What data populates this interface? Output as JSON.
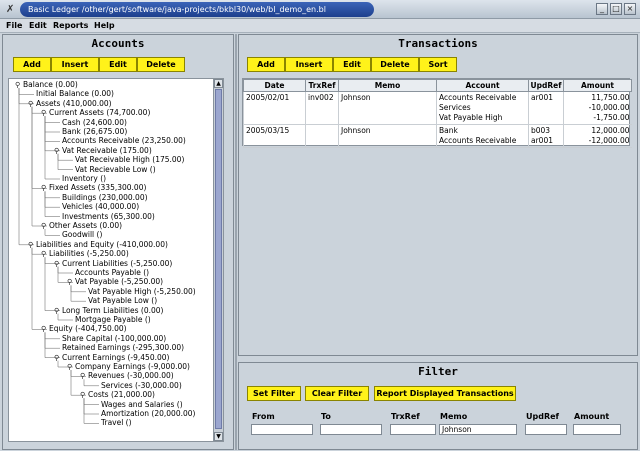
{
  "window": {
    "title": "Basic Ledger  /other/gert/software/java-projects/bkbl30/web/bl_demo_en.bl",
    "controls": [
      "_",
      "□",
      "×"
    ]
  },
  "menu": [
    "File",
    "Edit",
    "Reports",
    "Help"
  ],
  "accounts": {
    "title": "Accounts",
    "buttons": [
      "Add",
      "Insert",
      "Edit",
      "Delete"
    ],
    "tree": [
      {
        "label": "Balance (0.00)",
        "depth": 0,
        "key": true
      },
      {
        "label": "Initial Balance (0.00)",
        "depth": 1,
        "key": false
      },
      {
        "label": "Assets (410,000.00)",
        "depth": 1,
        "key": true
      },
      {
        "label": "Current Assets (74,700.00)",
        "depth": 2,
        "key": true
      },
      {
        "label": "Cash (24,600.00)",
        "depth": 3,
        "key": false
      },
      {
        "label": "Bank (26,675.00)",
        "depth": 3,
        "key": false
      },
      {
        "label": "Accounts Receivable (23,250.00)",
        "depth": 3,
        "key": false
      },
      {
        "label": "Vat Receivable (175.00)",
        "depth": 3,
        "key": true
      },
      {
        "label": "Vat Receivable High (175.00)",
        "depth": 4,
        "key": false
      },
      {
        "label": "Vat Recievable Low ()",
        "depth": 4,
        "key": false
      },
      {
        "label": "Inventory ()",
        "depth": 3,
        "key": false
      },
      {
        "label": "Fixed Assets (335,300.00)",
        "depth": 2,
        "key": true
      },
      {
        "label": "Buildings (230,000.00)",
        "depth": 3,
        "key": false
      },
      {
        "label": "Vehicles (40,000.00)",
        "depth": 3,
        "key": false
      },
      {
        "label": "Investments (65,300.00)",
        "depth": 3,
        "key": false
      },
      {
        "label": "Other Assets (0.00)",
        "depth": 2,
        "key": true
      },
      {
        "label": "Goodwill ()",
        "depth": 3,
        "key": false
      },
      {
        "label": "Liabilities and Equity (-410,000.00)",
        "depth": 1,
        "key": true
      },
      {
        "label": "Liabilities (-5,250.00)",
        "depth": 2,
        "key": true
      },
      {
        "label": "Current Liabilities (-5,250.00)",
        "depth": 3,
        "key": true
      },
      {
        "label": "Accounts Payable ()",
        "depth": 4,
        "key": false
      },
      {
        "label": "Vat Payable (-5,250.00)",
        "depth": 4,
        "key": true
      },
      {
        "label": "Vat Payable High (-5,250.00)",
        "depth": 5,
        "key": false
      },
      {
        "label": "Vat Payable Low ()",
        "depth": 5,
        "key": false
      },
      {
        "label": "Long Term Liabilities (0.00)",
        "depth": 3,
        "key": true
      },
      {
        "label": "Mortgage Payable ()",
        "depth": 4,
        "key": false
      },
      {
        "label": "Equity (-404,750.00)",
        "depth": 2,
        "key": true
      },
      {
        "label": "Share Capital (-100,000.00)",
        "depth": 3,
        "key": false
      },
      {
        "label": "Retained Earnings (-295,300.00)",
        "depth": 3,
        "key": false
      },
      {
        "label": "Current Earnings (-9,450.00)",
        "depth": 3,
        "key": true
      },
      {
        "label": "Company Earnings (-9,000.00)",
        "depth": 4,
        "key": true
      },
      {
        "label": "Revenues (-30,000.00)",
        "depth": 5,
        "key": true
      },
      {
        "label": "Services (-30,000.00)",
        "depth": 6,
        "key": false
      },
      {
        "label": "Costs (21,000.00)",
        "depth": 5,
        "key": true
      },
      {
        "label": "Wages and Salaries ()",
        "depth": 6,
        "key": false
      },
      {
        "label": "Amortization (20,000.00)",
        "depth": 6,
        "key": false
      },
      {
        "label": "Travel ()",
        "depth": 6,
        "key": false
      }
    ]
  },
  "transactions": {
    "title": "Transactions",
    "buttons": [
      "Add",
      "Insert",
      "Edit",
      "Delete",
      "Sort"
    ],
    "columns": [
      "Date",
      "TrxRef",
      "Memo",
      "Account",
      "UpdRef",
      "Amount"
    ],
    "rows": [
      {
        "date": "2005/02/01",
        "trxref": "inv002",
        "memo": "Johnson",
        "accounts": [
          "Accounts Receivable",
          "Services",
          "Vat Payable High"
        ],
        "updrefs": [
          "ar001",
          "",
          ""
        ],
        "amounts": [
          "11,750.00",
          "-10,000.00",
          "-1,750.00"
        ]
      },
      {
        "date": "2005/03/15",
        "trxref": "",
        "memo": "Johnson",
        "accounts": [
          "Bank",
          "Accounts Receivable"
        ],
        "updrefs": [
          "b003",
          "ar001"
        ],
        "amounts": [
          "12,000.00",
          "-12,000.00"
        ]
      }
    ]
  },
  "filter": {
    "title": "Filter",
    "buttons": [
      "Set Filter",
      "Clear Filter",
      "Report Displayed Transactions"
    ],
    "fields": [
      {
        "label": "From",
        "value": ""
      },
      {
        "label": "To",
        "value": ""
      },
      {
        "label": "TrxRef",
        "value": ""
      },
      {
        "label": "Memo",
        "value": "Johnson"
      },
      {
        "label": "UpdRef",
        "value": ""
      },
      {
        "label": "Amount",
        "value": ""
      }
    ]
  }
}
